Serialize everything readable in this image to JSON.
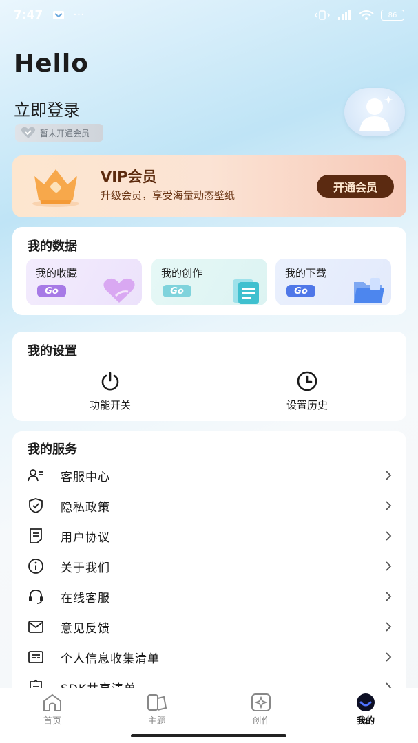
{
  "status_bar": {
    "time": "7:47",
    "more": "···",
    "battery": "86"
  },
  "header": {
    "greeting": "Hello",
    "login": "立即登录",
    "member_status": "暂未开通会员"
  },
  "vip": {
    "title": "VIP会员",
    "subtitle": "升级会员，享受海量动态壁纸",
    "button": "开通会员"
  },
  "my_data": {
    "title": "我的数据",
    "items": [
      {
        "label": "我的收藏",
        "go": "Go",
        "go_color": "#a77ae6"
      },
      {
        "label": "我的创作",
        "go": "Go",
        "go_color": "#7fd3dc"
      },
      {
        "label": "我的下载",
        "go": "Go",
        "go_color": "#4f77e8"
      }
    ]
  },
  "my_settings": {
    "title": "我的设置",
    "items": [
      {
        "label": "功能开关",
        "icon": "power-icon"
      },
      {
        "label": "设置历史",
        "icon": "clock-icon"
      }
    ]
  },
  "my_services": {
    "title": "我的服务",
    "items": [
      {
        "label": "客服中心",
        "icon": "user-list-icon"
      },
      {
        "label": "隐私政策",
        "icon": "shield-check-icon"
      },
      {
        "label": "用户协议",
        "icon": "document-icon"
      },
      {
        "label": "关于我们",
        "icon": "info-icon"
      },
      {
        "label": "在线客服",
        "icon": "headset-icon"
      },
      {
        "label": "意见反馈",
        "icon": "mail-icon"
      },
      {
        "label": "个人信息收集清单",
        "icon": "id-card-icon"
      },
      {
        "label": "SDK共享清单",
        "icon": "list-icon"
      }
    ]
  },
  "bottom_nav": {
    "items": [
      {
        "label": "首页",
        "icon": "home-icon"
      },
      {
        "label": "主题",
        "icon": "theme-icon"
      },
      {
        "label": "创作",
        "icon": "create-icon"
      },
      {
        "label": "我的",
        "icon": "profile-icon"
      }
    ],
    "active": "我的"
  },
  "colors": {
    "vip_button": "#5b2a11",
    "accent_active": "#2b3bd6"
  }
}
